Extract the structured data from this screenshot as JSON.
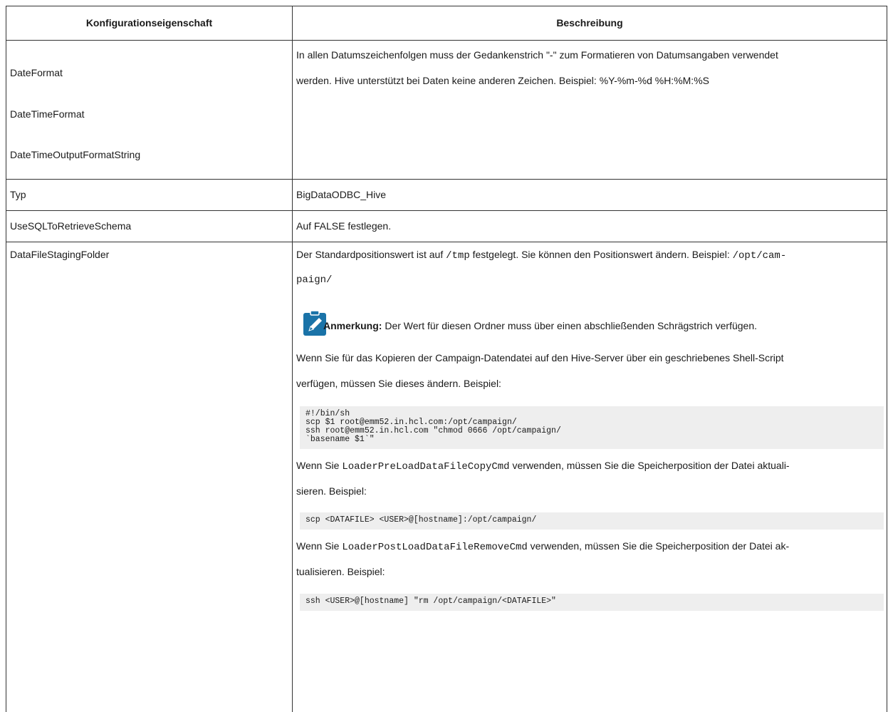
{
  "headers": {
    "col1": "Konfigurationseigenschaft",
    "col2": "Beschreibung"
  },
  "rows": {
    "dateformat": {
      "props": [
        "DateFormat",
        "DateTimeFormat",
        "DateTimeOutputFormatString"
      ],
      "desc_line1": "In allen Datumszeichenfolgen muss der Gedankenstrich \"-\" zum Formatieren von Datumsangaben verwendet",
      "desc_line2": "werden. Hive unterstützt bei Daten keine anderen Zeichen. Beispiel: %Y-%m-%d %H:%M:%S"
    },
    "typ": {
      "prop": "Typ",
      "desc": "BigDataODBC_Hive"
    },
    "usesql": {
      "prop": "UseSQLToRetrieveSchema",
      "desc": "Auf FALSE festlegen."
    },
    "staging": {
      "prop": "DataFileStagingFolder",
      "p1_a": "Der Standardpositionswert ist auf ",
      "p1_code1": "/tmp",
      "p1_b": " festgelegt. Sie können den Positionswert ändern. Beispiel: ",
      "p1_code2": "/opt/cam-",
      "p1_code3": "paign/",
      "note_label": "Anmerkung:",
      "note_text": " Der Wert für diesen Ordner muss über einen abschließenden Schrägstrich verfügen.",
      "p2_line1": "Wenn Sie für das Kopieren der Campaign-Datendatei auf den Hive-Server über ein geschriebenes Shell-Script",
      "p2_line2": "verfügen, müssen Sie dieses ändern. Beispiel:",
      "code1": "#!/bin/sh\nscp $1 root@emm52.in.hcl.com:/opt/campaign/\nssh root@emm52.in.hcl.com \"chmod 0666 /opt/campaign/\n`basename $1`\"",
      "p3_a": "Wenn Sie ",
      "p3_code": "LoaderPreLoadDataFileCopyCmd",
      "p3_b": " verwenden, müssen Sie die Speicherposition der Datei aktuali-",
      "p3_line2": "sieren. Beispiel:",
      "code2": "scp <DATAFILE> <USER>@[hostname]:/opt/campaign/",
      "p4_a": "Wenn Sie ",
      "p4_code": "LoaderPostLoadDataFileRemoveCmd",
      "p4_b": " verwenden, müssen Sie die Speicherposition der Datei ak-",
      "p4_line2": "tualisieren. Beispiel:",
      "code3": "ssh <USER>@[hostname] \"rm /opt/campaign/<DATAFILE>\""
    }
  },
  "colors": {
    "border": "#333333",
    "code_bg": "#eeeeee",
    "note_icon": "#1a73a8"
  },
  "icons": {
    "note": "pencil-note-icon"
  }
}
